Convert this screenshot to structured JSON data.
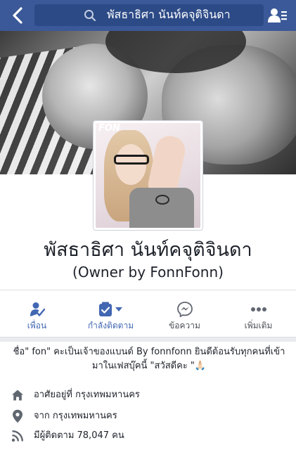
{
  "header": {
    "search_text": "พัสธาธิศา นันท์คจุติจินดา",
    "back_icon": "chevron-left-icon",
    "search_icon": "search-icon",
    "friends_icon": "friends-list-icon",
    "bar_color": "#3b5998"
  },
  "cover": {
    "watermark_text": "FON"
  },
  "profile": {
    "name": "พัสธาธิศา นันท์คจุติจินดา",
    "subtitle": "(Owner by FonnFonn)"
  },
  "actions": [
    {
      "label": "เพื่อน",
      "icon": "friends-check-icon",
      "active": true
    },
    {
      "label": "กำลังติดตาม",
      "icon": "following-feed-icon",
      "active": true
    },
    {
      "label": "ข้อความ",
      "icon": "messenger-icon",
      "active": false
    },
    {
      "label": "เพิ่มเติม",
      "icon": "more-dots-icon",
      "active": false
    }
  ],
  "about": {
    "bio_line1": "ชื่อ\" fon\" คะเป็นเจ้าของแบนด์ By fonnfonn ยินดีต้อนรับทุกคนที่เข้า",
    "bio_line2": "มาในเฟสบุ๊คนี้ \"สวัสดีคะ \"🙏🏻",
    "rows": [
      {
        "icon": "home-icon",
        "text": "อาศัยอยู่ที่ กรุงเทพมหานคร"
      },
      {
        "icon": "location-pin-icon",
        "text": "จาก กรุงเทพมหานคร"
      },
      {
        "icon": "rss-followers-icon",
        "text": "มีผู้ติดตาม 78,047 คน"
      }
    ]
  },
  "colors": {
    "accent": "#4267b2",
    "icon_gray": "#616770",
    "divider": "#dddfe2"
  }
}
